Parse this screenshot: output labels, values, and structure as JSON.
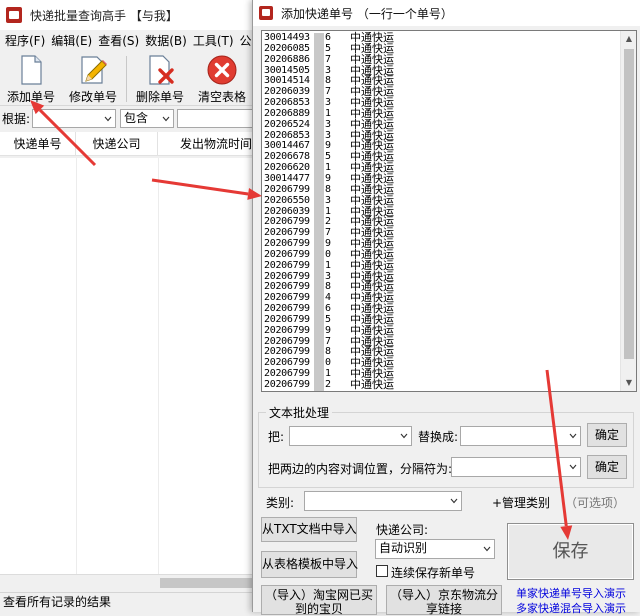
{
  "main_window": {
    "title": "快递批量查询高手 【与我】",
    "menu": [
      "程序(F)",
      "编辑(E)",
      "查看(S)",
      "数据(B)",
      "工具(T)",
      "公告(X)"
    ],
    "toolbar": {
      "add_label": "添加单号",
      "edit_label": "修改单号",
      "delete_label": "删除单号",
      "clear_label": "清空表格"
    },
    "filter": {
      "basis_label": "根据:",
      "basis_value": "",
      "mode_value": "包含",
      "keyword_value": ""
    },
    "columns": [
      "快递单号",
      "快递公司",
      "发出物流时间"
    ],
    "status_text": "查看所有记录的结果"
  },
  "dialog": {
    "title": "添加快递单号 （一行一个单号）",
    "courier_label": "中通快运",
    "tracking_numbers": [
      "30014493",
      "20206085",
      "20206886",
      "30014505",
      "30014514",
      "20206039",
      "20206853",
      "20206889",
      "20206524",
      "20206853",
      "30014467",
      "20206678",
      "20206620",
      "30014477",
      "20206799",
      "20206550",
      "20206039",
      "20206799",
      "20206799",
      "20206799",
      "20206799",
      "20206799",
      "20206799",
      "20206799",
      "20206799",
      "20206799",
      "20206799",
      "20206799",
      "20206799",
      "20206799",
      "20206799",
      "20206799",
      "20206799"
    ],
    "tracking_suffix_digits": [
      "6",
      "5",
      "7",
      "3",
      "8",
      "7",
      "3",
      "1",
      "3",
      "3",
      "9",
      "5",
      "1",
      "9",
      "8",
      "3",
      "1",
      "2",
      "7",
      "9",
      "0",
      "1",
      "3",
      "8",
      "4",
      "6",
      "5",
      "9",
      "7",
      "8",
      "0",
      "1",
      "2"
    ],
    "text_batch": {
      "group_title": "文本批处理",
      "replace_from_label": "把:",
      "replace_from_value": "",
      "replace_to_label": "替换成:",
      "replace_to_value": "",
      "confirm_label": "确定",
      "swap_label": "把两边的内容对调位置，分隔符为:",
      "swap_value": "",
      "confirm2_label": "确定"
    },
    "category_label": "类别:",
    "category_value": "",
    "manage_category_label": "+管理类别",
    "optional_label": "（可选项）",
    "import_txt_label": "从TXT文档中导入",
    "import_template_label": "从表格模板中导入",
    "courier_company_label": "快递公司:",
    "courier_company_value": "自动识别",
    "continuous_save_label": "连续保存新单号",
    "continuous_save_checked": false,
    "save_label": "保存",
    "import_taobao_label": "（导入）淘宝网已买到的宝贝",
    "import_jd_label": "（导入）京东物流分享链接",
    "link_single_label": "单家快递单号导入演示",
    "link_multi_label": "多家快递混合导入演示"
  },
  "annotation_color": "#e53935"
}
